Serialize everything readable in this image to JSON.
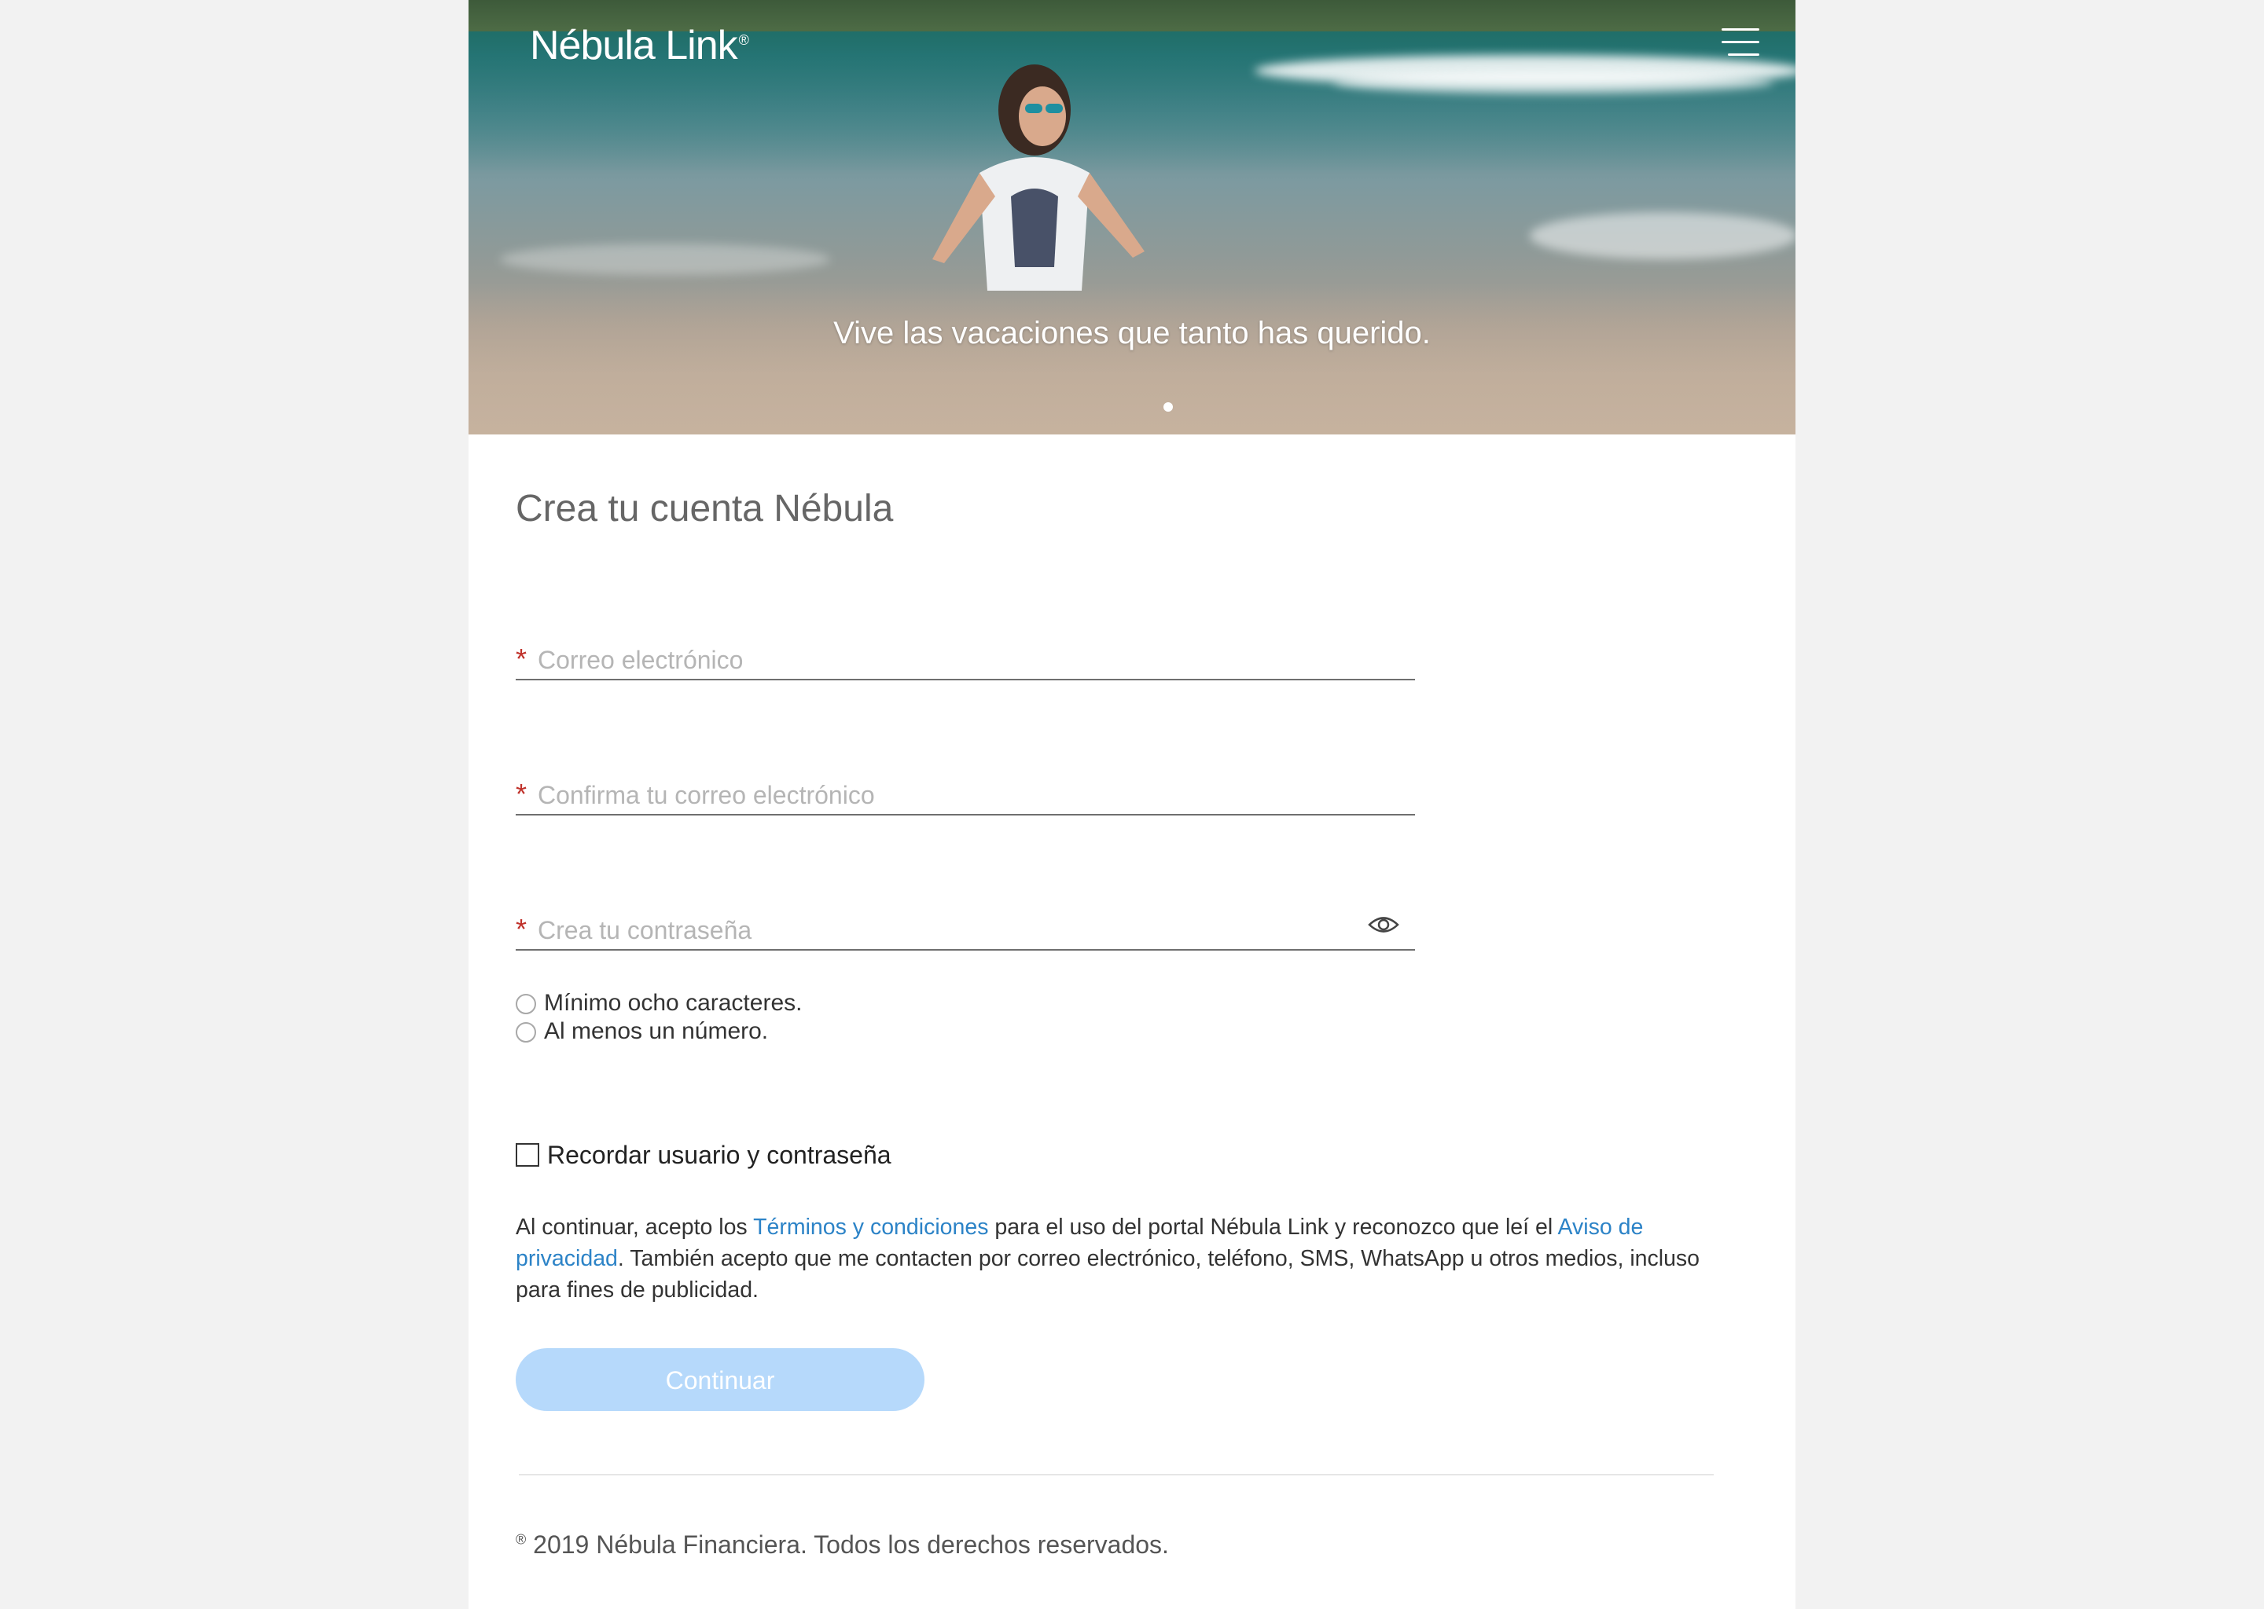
{
  "header": {
    "logo_text": "Nébula Link",
    "logo_mark": "®",
    "menu_icon": "hamburger-menu-icon"
  },
  "hero": {
    "caption": "Vive las vacaciones que tanto has querido.",
    "carousel_active_index": 1,
    "carousel_count": 1
  },
  "form": {
    "title": "Crea tu cuenta Nébula",
    "required_mark": "*",
    "email_placeholder": "Correo electrónico",
    "confirm_email_placeholder": "Confirma tu correo electrónico",
    "password_placeholder": "Crea tu contraseña",
    "password_toggle_icon": "eye-icon",
    "password_rules": [
      "Mínimo ocho caracteres.",
      "Al menos un número."
    ],
    "remember_label": "Recordar usuario y contraseña",
    "remember_checked": false
  },
  "legal": {
    "text_1": "Al continuar, acepto los ",
    "terms_link": "Términos y condiciones",
    "text_2": " para el uso del portal Nébula Link y reconozco que leí el ",
    "privacy_link": "Aviso de privacidad",
    "text_3": ". También acepto que me contacten por correo electrónico, teléfono, SMS, WhatsApp u otros medios, incluso para fines de publicidad."
  },
  "actions": {
    "continue_label": "Continuar",
    "continue_color": "#b6d9fb"
  },
  "footer": {
    "mark": "®",
    "text": "2019 Nébula Financiera. Todos los derechos reservados."
  },
  "colors": {
    "required": "#c0322b",
    "link": "#2c83c7",
    "background": "#f2f2f2"
  }
}
